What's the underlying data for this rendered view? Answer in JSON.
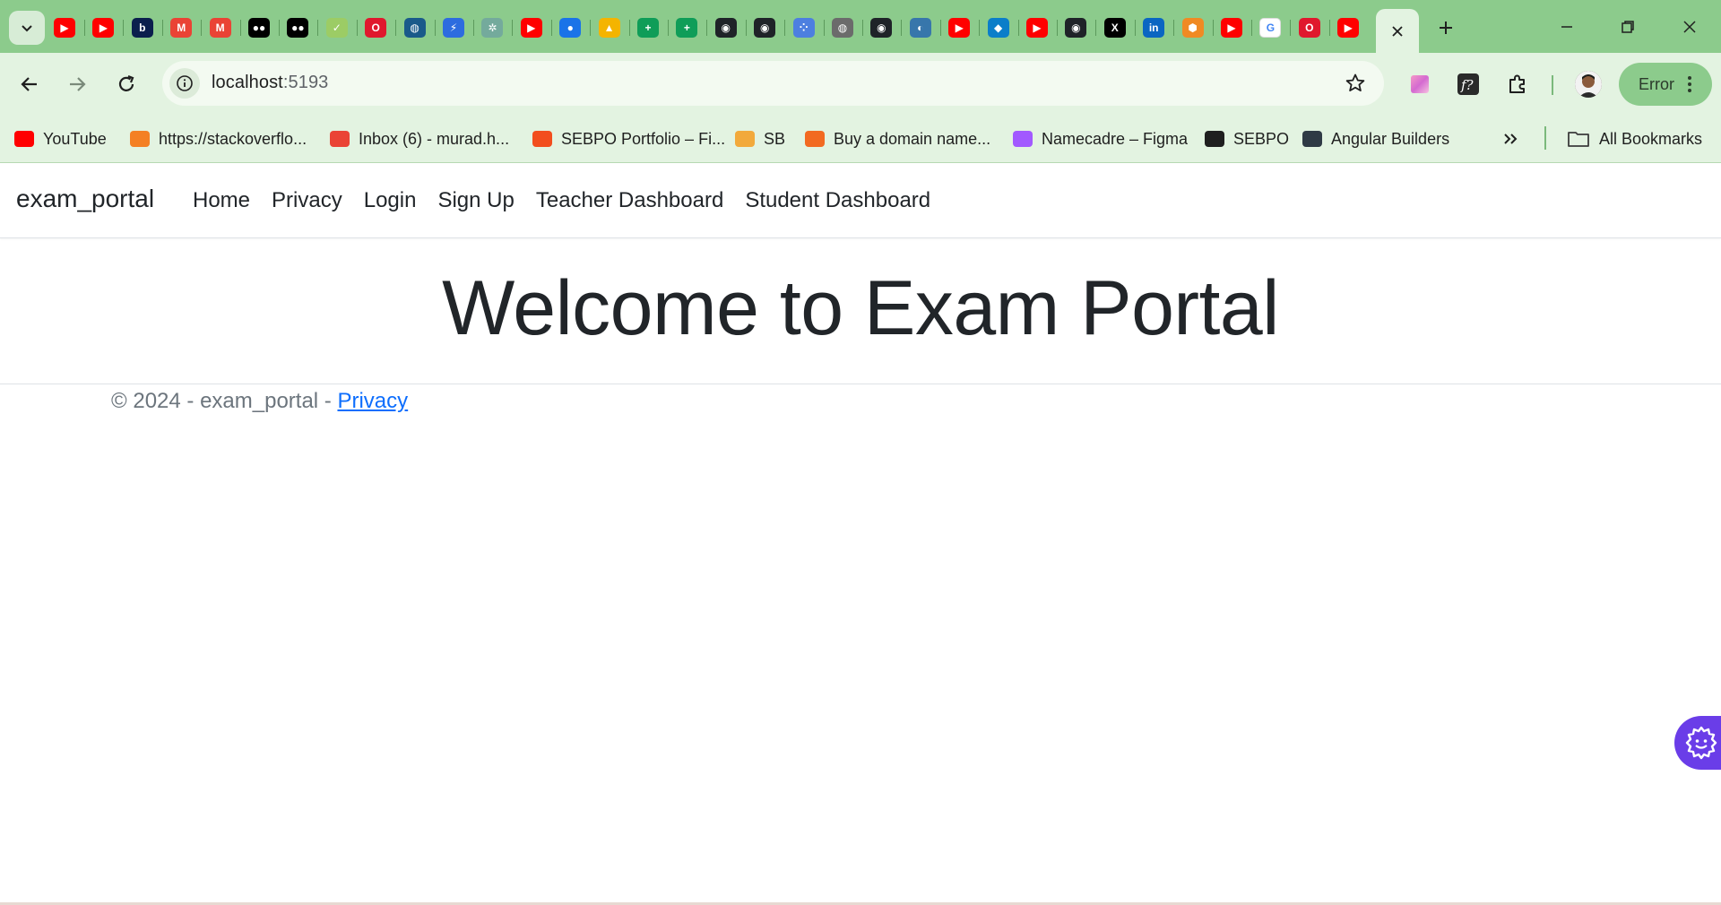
{
  "browser": {
    "tab_icons": [
      {
        "icon": "youtube-icon",
        "color": "#ff0000",
        "glyph": "▶"
      },
      {
        "icon": "youtube-icon",
        "color": "#ff0000",
        "glyph": "▶"
      },
      {
        "icon": "b-icon",
        "color": "#0b1f4d",
        "glyph": "b"
      },
      {
        "icon": "gmail-icon",
        "color": "#ea4335",
        "glyph": "M"
      },
      {
        "icon": "gmail-icon",
        "color": "#ea4335",
        "glyph": "M"
      },
      {
        "icon": "medium-icon",
        "color": "#000000",
        "glyph": "●●"
      },
      {
        "icon": "medium-icon",
        "color": "#000000",
        "glyph": "●●"
      },
      {
        "icon": "check-icon",
        "color": "#9ccc65",
        "glyph": "✓"
      },
      {
        "icon": "opera-icon",
        "color": "#e0182d",
        "glyph": "O"
      },
      {
        "icon": "globe-icon",
        "color": "#1a5a8a",
        "glyph": "◍"
      },
      {
        "icon": "bolt-icon",
        "color": "#2d6cdf",
        "glyph": "⚡"
      },
      {
        "icon": "chatgpt-icon",
        "color": "#74aa9c",
        "glyph": "✲"
      },
      {
        "icon": "youtube-icon",
        "color": "#ff0000",
        "glyph": "▶"
      },
      {
        "icon": "contacts-icon",
        "color": "#1a73e8",
        "glyph": "●"
      },
      {
        "icon": "drive-icon",
        "color": "#f4b400",
        "glyph": "▲"
      },
      {
        "icon": "plus-sheet-icon",
        "color": "#0f9d58",
        "glyph": "+"
      },
      {
        "icon": "plus-sheet-icon",
        "color": "#0f9d58",
        "glyph": "+"
      },
      {
        "icon": "github-icon",
        "color": "#1f2328",
        "glyph": "◉"
      },
      {
        "icon": "github-icon",
        "color": "#1f2328",
        "glyph": "◉"
      },
      {
        "icon": "dots-icon",
        "color": "#4d7fe0",
        "glyph": "⁘"
      },
      {
        "icon": "globe-grey-icon",
        "color": "#6b6b6b",
        "glyph": "◍"
      },
      {
        "icon": "github-icon",
        "color": "#1f2328",
        "glyph": "◉"
      },
      {
        "icon": "python-icon",
        "color": "#3776ab",
        "glyph": "◐"
      },
      {
        "icon": "youtube-icon",
        "color": "#ff0000",
        "glyph": "▶"
      },
      {
        "icon": "cloud-icon",
        "color": "#0b7ec9",
        "glyph": "◆"
      },
      {
        "icon": "youtube-icon",
        "color": "#ff0000",
        "glyph": "▶"
      },
      {
        "icon": "github-icon",
        "color": "#1f2328",
        "glyph": "◉"
      },
      {
        "icon": "x-icon",
        "color": "#000000",
        "glyph": "X"
      },
      {
        "icon": "linkedin-icon",
        "color": "#0a66c2",
        "glyph": "in"
      },
      {
        "icon": "shield-icon",
        "color": "#f08a24",
        "glyph": "⬢"
      },
      {
        "icon": "youtube-icon",
        "color": "#ff0000",
        "glyph": "▶"
      },
      {
        "icon": "google-icon",
        "color": "#ffffff",
        "glyph": "G"
      },
      {
        "icon": "opera-icon",
        "color": "#e0182d",
        "glyph": "O"
      },
      {
        "icon": "youtube-icon",
        "color": "#ff0000",
        "glyph": "▶"
      }
    ],
    "address": {
      "host": "localhost",
      "port": ":5193"
    },
    "profile_button_label": "Error",
    "bookmarks": [
      {
        "label": "YouTube",
        "icon": "youtube-icon",
        "color": "#ff0000"
      },
      {
        "label": "https://stackoverflo...",
        "icon": "stackoverflow-icon",
        "color": "#f48024"
      },
      {
        "label": "Inbox (6) - murad.h...",
        "icon": "gmail-icon",
        "color": "#ea4335"
      },
      {
        "label": "SEBPO Portfolio – Fi...",
        "icon": "figma-icon",
        "color": "#f24e1e"
      },
      {
        "label": "SB",
        "icon": "sb-icon",
        "color": "#f2a93b"
      },
      {
        "label": "Buy a domain name...",
        "icon": "namecheap-icon",
        "color": "#f26a21"
      },
      {
        "label": "Namecadre – Figma",
        "icon": "figma-icon",
        "color": "#a259ff"
      },
      {
        "label": "SEBPO",
        "icon": "globe-icon",
        "color": "#1f1f1f"
      },
      {
        "label": "Angular Builders",
        "icon": "angular-builders-icon",
        "color": "#2f3a45"
      }
    ],
    "all_bookmarks_label": "All Bookmarks"
  },
  "site": {
    "brand": "exam_portal",
    "nav": [
      "Home",
      "Privacy",
      "Login",
      "Sign Up",
      "Teacher Dashboard",
      "Student Dashboard"
    ],
    "heading": "Welcome to Exam Portal",
    "footer": {
      "copyright": "© 2024 - exam_portal - ",
      "privacy_link": "Privacy"
    }
  },
  "colors": {
    "chrome_green": "#8ccb8c",
    "toolbar_green": "#e3f3e1",
    "link_blue": "#0d6efd",
    "widget_purple": "#6a3de8"
  }
}
